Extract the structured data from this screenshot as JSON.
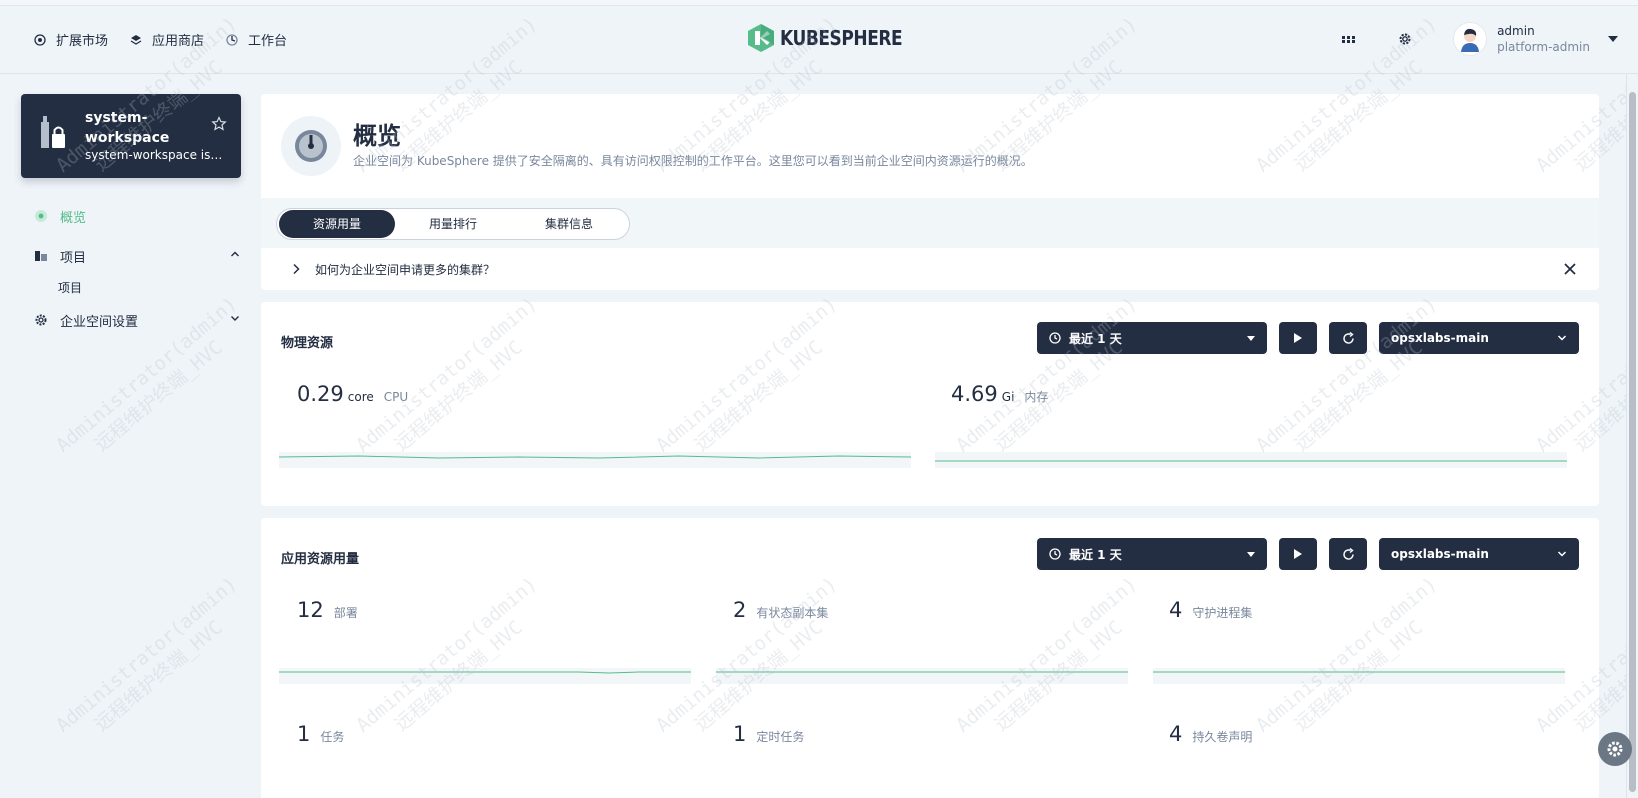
{
  "topbar": {
    "nav": [
      {
        "label": "扩展市场",
        "icon": "extension-icon"
      },
      {
        "label": "应用商店",
        "icon": "app-store-icon"
      },
      {
        "label": "工作台",
        "icon": "workbench-icon"
      }
    ],
    "logo_text": "KUBESPHERE",
    "user": {
      "name": "admin",
      "role": "platform-admin"
    }
  },
  "workspace": {
    "name": "system-workspace",
    "description": "system-workspace is a ..."
  },
  "sidebar": {
    "items": [
      {
        "label": "概览",
        "active": true
      },
      {
        "label": "项目"
      },
      {
        "label": "企业空间设置"
      }
    ],
    "sub_items": [
      {
        "label": "项目"
      }
    ]
  },
  "header": {
    "title": "概览",
    "description": "企业空间为 KubeSphere 提供了安全隔离的、具有访问权限控制的工作平台。这里您可以看到当前企业空间内资源运行的概况。",
    "tabs": [
      {
        "label": "资源用量",
        "active": true
      },
      {
        "label": "用量排行"
      },
      {
        "label": "集群信息"
      }
    ],
    "tip": "如何为企业空间申请更多的集群？"
  },
  "physical": {
    "title": "物理资源",
    "time_range": "最近 1 天",
    "cluster": "opsxlabs-main",
    "metrics": [
      {
        "value": "0.29",
        "unit": "core",
        "label": "CPU"
      },
      {
        "value": "4.69",
        "unit": "Gi",
        "label": "内存"
      }
    ]
  },
  "app_usage": {
    "title": "应用资源用量",
    "time_range": "最近 1 天",
    "cluster": "opsxlabs-main",
    "metrics": [
      {
        "value": "12",
        "label": "部署"
      },
      {
        "value": "2",
        "label": "有状态副本集"
      },
      {
        "value": "4",
        "label": "守护进程集"
      },
      {
        "value": "1",
        "label": "任务"
      },
      {
        "value": "1",
        "label": "定时任务"
      },
      {
        "value": "4",
        "label": "持久卷声明"
      }
    ]
  },
  "watermark": {
    "line1": "Administrator(admin)",
    "line2": "远程维护终端_HVC"
  },
  "colors": {
    "accent": "#55bc8a",
    "dark": "#242e42",
    "muted": "#79879c",
    "background": "#eff4f9"
  }
}
